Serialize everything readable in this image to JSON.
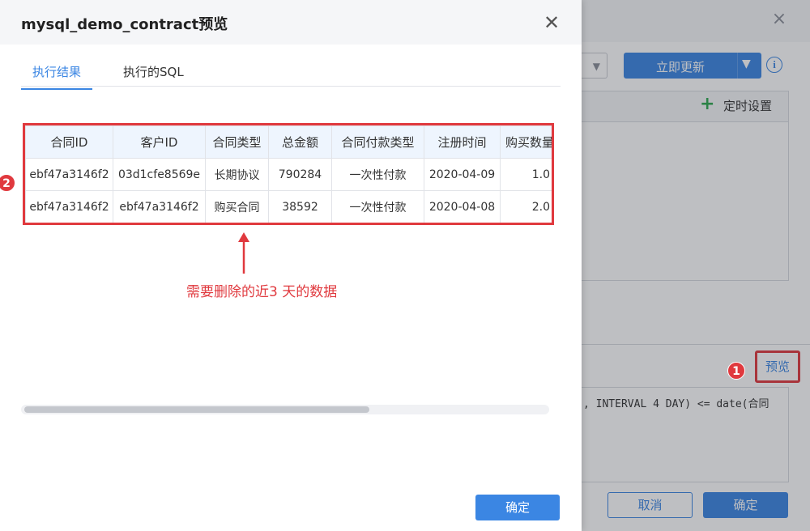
{
  "background": {
    "update_button_label": "立即更新",
    "timer_label": "定时设置",
    "preview_label": "预览",
    "sql_snippet": ", INTERVAL 4 DAY) <= date(合同",
    "cancel_label": "取消",
    "confirm_label": "确定"
  },
  "modal": {
    "title": "mysql_demo_contract预览",
    "tabs": [
      {
        "label": "执行结果",
        "active": true
      },
      {
        "label": "执行的SQL",
        "active": false
      }
    ],
    "table": {
      "columns": [
        "合同ID",
        "客户ID",
        "合同类型",
        "总金额",
        "合同付款类型",
        "注册时间",
        "购买数量"
      ],
      "rows": [
        [
          "ebf47a3146f2",
          "03d1cfe8569e",
          "长期协议",
          "790284",
          "一次性付款",
          "2020-04-09",
          "1.0"
        ],
        [
          "ebf47a3146f2",
          "ebf47a3146f2",
          "购买合同",
          "38592",
          "一次性付款",
          "2020-04-08",
          "2.0"
        ]
      ]
    },
    "annotation": "需要删除的近3 天的数据",
    "confirm_label": "确定"
  },
  "badges": {
    "one": "1",
    "two": "2"
  },
  "colors": {
    "accent": "#3b86e3",
    "highlight": "#e0393e",
    "plus": "#2fa84f"
  }
}
